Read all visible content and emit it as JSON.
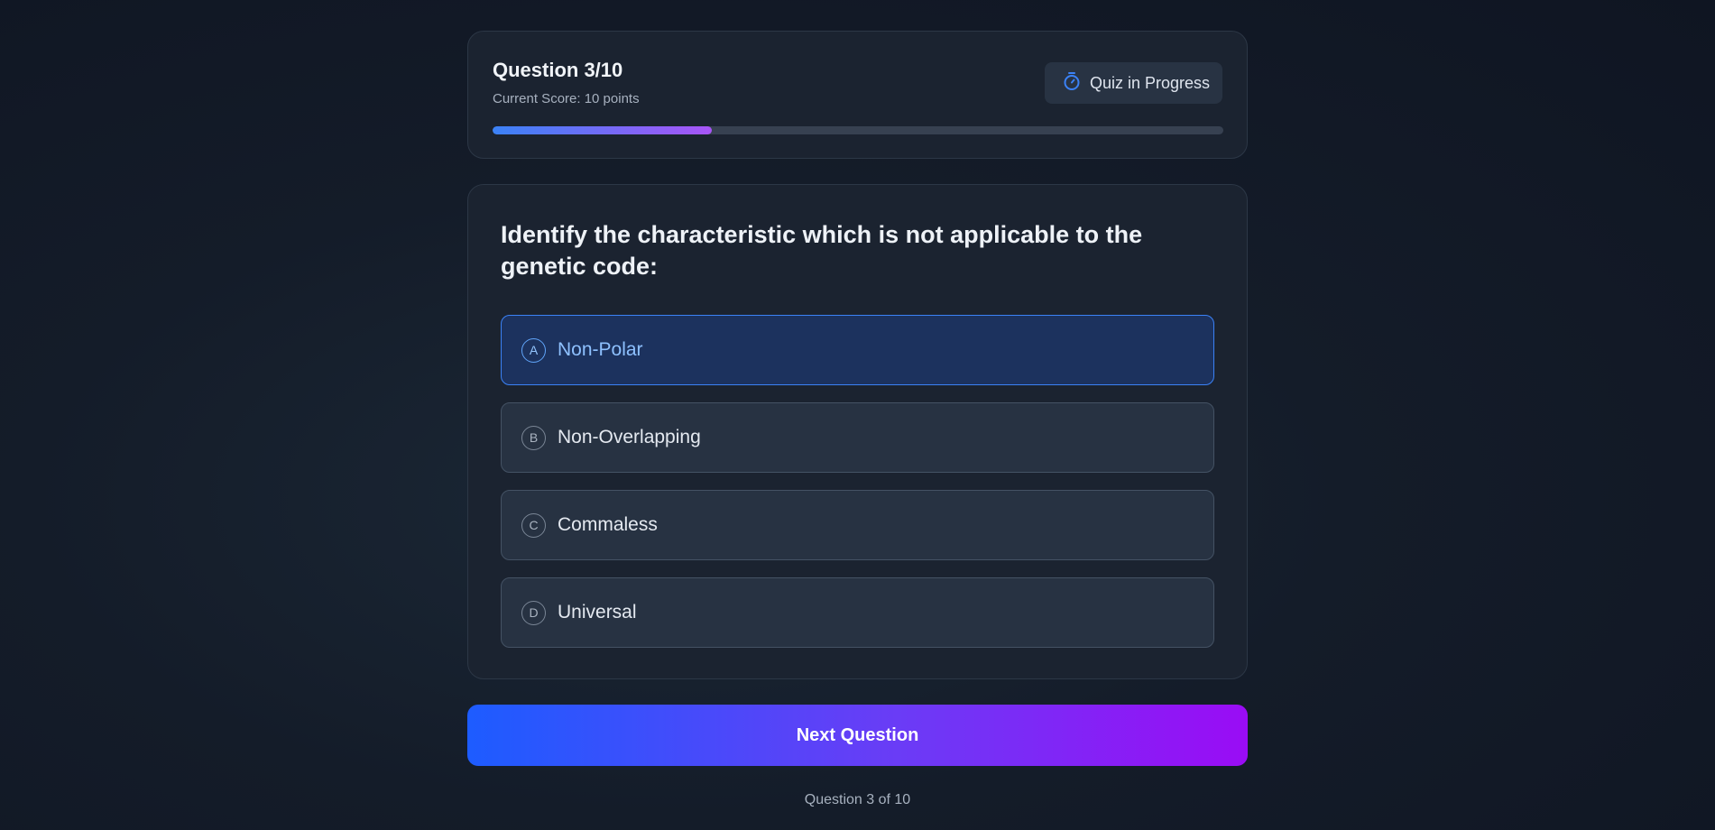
{
  "header": {
    "question_counter": "Question 3/10",
    "score_text": "Current Score: 10 points",
    "status_label": "Quiz in Progress",
    "status_icon": "stopwatch-icon",
    "progress_fraction": 0.3
  },
  "question": {
    "text": "Identify the characteristic which is not applicable to the genetic code:",
    "options": [
      {
        "letter": "A",
        "label": "Non-Polar",
        "selected": true
      },
      {
        "letter": "B",
        "label": "Non-Overlapping",
        "selected": false
      },
      {
        "letter": "C",
        "label": "Commaless",
        "selected": false
      },
      {
        "letter": "D",
        "label": "Universal",
        "selected": false
      }
    ]
  },
  "actions": {
    "next_label": "Next Question"
  },
  "footer": {
    "text": "Question 3 of 10"
  },
  "colors": {
    "accent_blue": "#3b82f6",
    "accent_purple": "#a855f7",
    "button_start": "#1d5cff",
    "button_end": "#9a0cf5"
  }
}
